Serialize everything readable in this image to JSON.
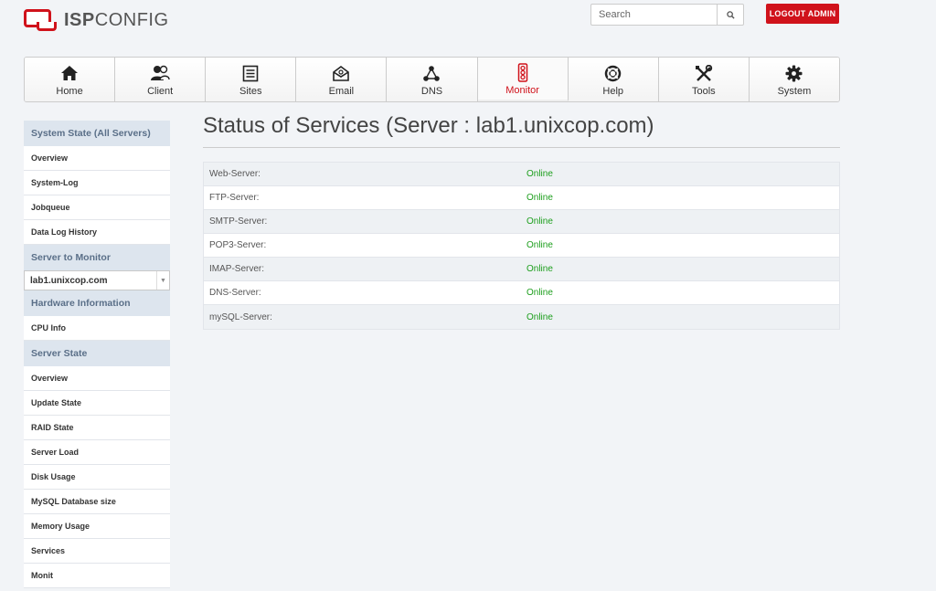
{
  "brand": {
    "strong": "ISP",
    "rest": "CONFIG"
  },
  "search": {
    "placeholder": "Search"
  },
  "logout_label": "LOGOUT ADMIN",
  "nav": [
    {
      "label": "Home",
      "icon": "home-icon"
    },
    {
      "label": "Client",
      "icon": "users-icon"
    },
    {
      "label": "Sites",
      "icon": "document-icon"
    },
    {
      "label": "Email",
      "icon": "envelope-icon"
    },
    {
      "label": "DNS",
      "icon": "network-icon"
    },
    {
      "label": "Monitor",
      "icon": "traffic-light-icon",
      "active": true
    },
    {
      "label": "Help",
      "icon": "lifebuoy-icon"
    },
    {
      "label": "Tools",
      "icon": "tools-icon"
    },
    {
      "label": "System",
      "icon": "gear-icon"
    }
  ],
  "sidebar": {
    "system_state_head": "System State (All Servers)",
    "system_state_items": [
      "Overview",
      "System-Log",
      "Jobqueue",
      "Data Log History"
    ],
    "server_monitor_head": "Server to Monitor",
    "server_select_value": "lab1.unixcop.com",
    "hardware_head": "Hardware Information",
    "hardware_items": [
      "CPU Info"
    ],
    "server_state_head": "Server State",
    "server_state_items": [
      "Overview",
      "Update State",
      "RAID State",
      "Server Load",
      "Disk Usage",
      "MySQL Database size",
      "Memory Usage",
      "Services",
      "Monit"
    ]
  },
  "main": {
    "title": "Status of Services (Server : lab1.unixcop.com)",
    "services": [
      {
        "name": "Web-Server:",
        "status": "Online"
      },
      {
        "name": "FTP-Server:",
        "status": "Online"
      },
      {
        "name": "SMTP-Server:",
        "status": "Online"
      },
      {
        "name": "POP3-Server:",
        "status": "Online"
      },
      {
        "name": "IMAP-Server:",
        "status": "Online"
      },
      {
        "name": "DNS-Server:",
        "status": "Online"
      },
      {
        "name": "mySQL-Server:",
        "status": "Online"
      }
    ]
  },
  "colors": {
    "accent": "#d0121b",
    "online": "#1c9e1c",
    "sidebar_head_bg": "#dde5ee"
  }
}
